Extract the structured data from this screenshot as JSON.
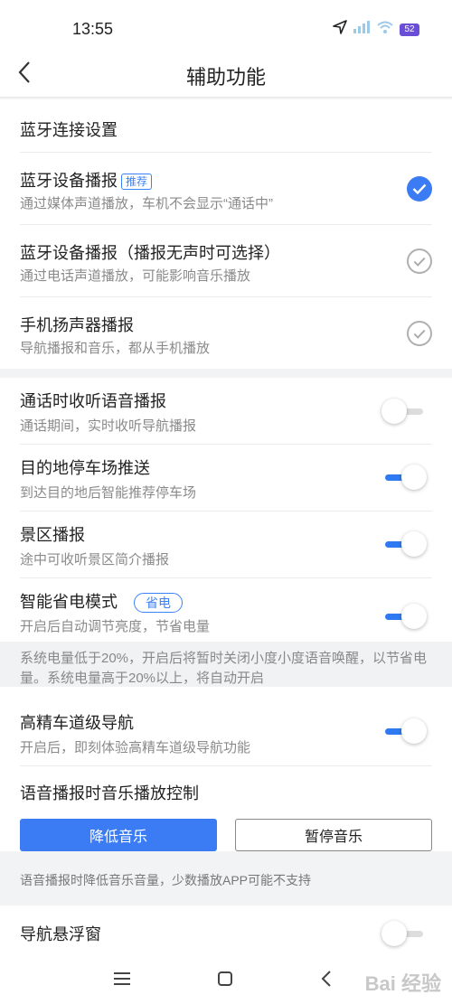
{
  "status_bar": {
    "time": "13:55",
    "battery": "52",
    "wifi_sub": "6"
  },
  "header": {
    "title": "辅助功能"
  },
  "bluetooth_section": {
    "title": "蓝牙连接设置",
    "options": [
      {
        "title": "蓝牙设备播报",
        "tag": "推荐",
        "desc": "通过媒体声道播放，车机不会显示“通话中”",
        "checked": true
      },
      {
        "title": "蓝牙设备播报（播报无声时可选择）",
        "desc": "通过电话声道播放，可能影响音乐播放",
        "checked": false
      },
      {
        "title": "手机扬声器播报",
        "desc": "导航播报和音乐，都从手机播放",
        "checked": false
      }
    ]
  },
  "settings": [
    {
      "title": "通话时收听语音播报",
      "desc": "通话期间，实时收听导航播报",
      "on": false
    },
    {
      "title": "目的地停车场推送",
      "desc": "到达目的地后智能推荐停车场",
      "on": true
    },
    {
      "title": "景区播报",
      "desc": "途中可收听景区简介播报",
      "on": true
    },
    {
      "title": "智能省电模式",
      "tag": "省电",
      "desc": "开启后自动调节亮度，节省电量",
      "on": true
    },
    {
      "title": "高精车道级导航",
      "desc": "开启后，即刻体验高精车道级导航功能",
      "on": true
    }
  ],
  "power_note": "系统电量低于20%，开启后将暂时关闭小度小度语音唤醒，以节省电量。系统电量高于20%以上，将自动开启",
  "music_control": {
    "title": "语音播报时音乐播放控制",
    "buttons": [
      "降低音乐",
      "暂停音乐"
    ],
    "selected": "降低音乐",
    "hint": "语音播报时降低音乐音量，少数播放APP可能不支持"
  },
  "floating_window": {
    "title": "导航悬浮窗",
    "on": false
  },
  "watermark": "Bai 经验",
  "colors": {
    "accent": "#3b7cf4",
    "toggle_on": "#2f7af2",
    "secondary_text": "#8a8a8a"
  },
  "icons": [
    "back-arrow-icon",
    "location-arrow-icon",
    "signal-icon",
    "wifi-icon",
    "battery-icon",
    "check-circle-icon",
    "menu-icon",
    "home-square-icon",
    "back-triangle-icon"
  ]
}
